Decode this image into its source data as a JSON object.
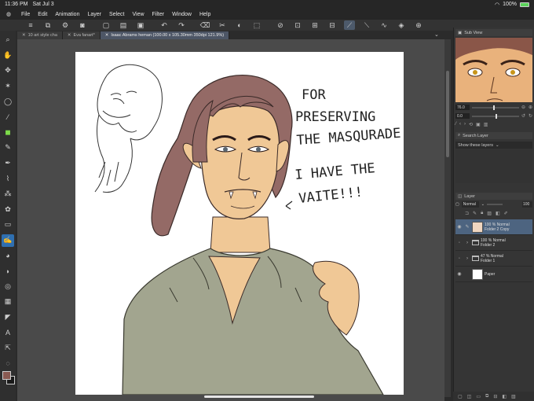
{
  "status": {
    "time": "11:36 PM",
    "date": "Sat Jul 3",
    "battery": "100%",
    "battery_level": 1.0
  },
  "menu": {
    "items": [
      "File",
      "Edit",
      "Animation",
      "Layer",
      "Select",
      "View",
      "Filter",
      "Window",
      "Help"
    ]
  },
  "tabs": [
    {
      "label": "10 art style cha",
      "active": false
    },
    {
      "label": "Eva fanart*",
      "active": false
    },
    {
      "label": "Isaac Abrams heman (100.00 x 105.30mm 350dpi 121.9%)",
      "active": true
    }
  ],
  "artwork": {
    "lines": [
      "FOR",
      "PRESERVING",
      "THE MASQURADE",
      "I HAVE THE",
      "VAITE!!!"
    ]
  },
  "panels": {
    "subview": {
      "title": "Sub View"
    },
    "navigator": {
      "zoom": "76.0",
      "angle": "0.0",
      "zoom_level": 0.45,
      "angle_level": 0.5
    },
    "search": {
      "title": "Search Layer",
      "filter": "Show these layers"
    },
    "layer": {
      "title": "Layer",
      "blend": "Normal",
      "opacity": "100",
      "layers": [
        {
          "opacity": "100 %",
          "mode": "Normal",
          "name": "Folder 2 Copy",
          "selected": true,
          "type": "raster"
        },
        {
          "opacity": "100 %",
          "mode": "Normal",
          "name": "Folder 2",
          "selected": false,
          "type": "folder"
        },
        {
          "opacity": "47 %",
          "mode": "Normal",
          "name": "Folder 1",
          "selected": false,
          "type": "folder"
        },
        {
          "opacity": "",
          "mode": "",
          "name": "Paper",
          "selected": false,
          "type": "paper"
        }
      ]
    }
  },
  "colors": {
    "main": "#8a5a52",
    "sub": "#1a1a1a",
    "accent": "#2f6fb0",
    "skin": "#f0c896",
    "shirt": "#a2a58f",
    "hair": "#946a66"
  }
}
